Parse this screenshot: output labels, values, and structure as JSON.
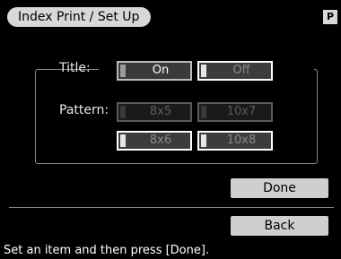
{
  "header": {
    "title": "Index Print / Set Up",
    "mode_badge": "P"
  },
  "settings": {
    "title_label": "Title:",
    "title_options": [
      {
        "label": "On",
        "state": "enabled"
      },
      {
        "label": "Off",
        "state": "selected"
      }
    ],
    "pattern_label": "Pattern:",
    "pattern_options": [
      {
        "label": "8x5",
        "state": "disabled"
      },
      {
        "label": "10x7",
        "state": "disabled"
      },
      {
        "label": "8x6",
        "state": "selected"
      },
      {
        "label": "10x8",
        "state": "selected"
      }
    ]
  },
  "actions": {
    "done_label": "Done",
    "back_label": "Back"
  },
  "status": {
    "message": "Set an item and then press [Done]."
  },
  "colors": {
    "background": "#000000",
    "tab_fill": "#d8d8d8",
    "button_fill": "#cfcfcf",
    "frame": "#8a8a8a"
  }
}
